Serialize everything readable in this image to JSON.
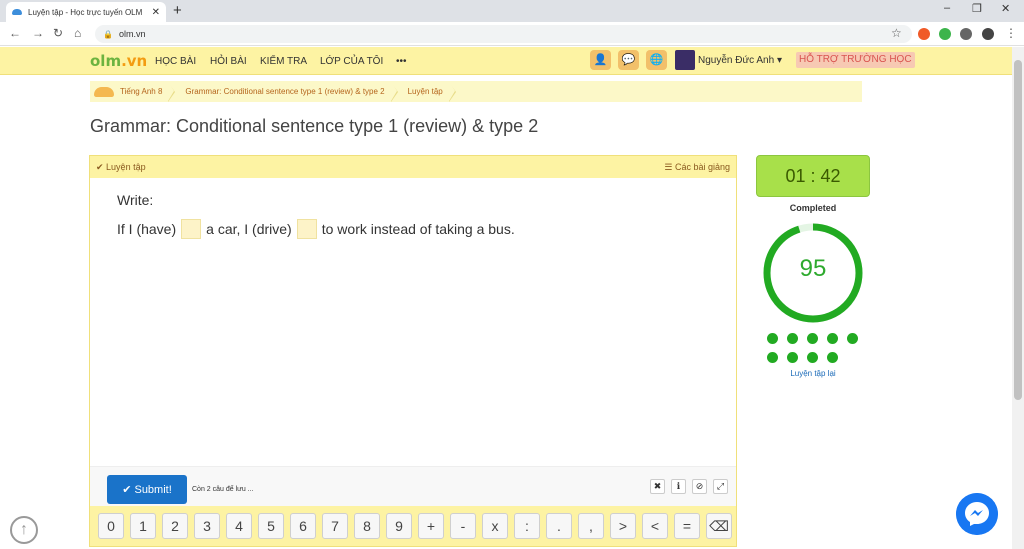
{
  "browser": {
    "tab_title": "Luyện tập - Học trực tuyến OLM",
    "tab_close": "✕",
    "new_tab": "+",
    "url": "olm.vn",
    "controls": {
      "minimize": "–",
      "restore": "❐",
      "close": "✕"
    }
  },
  "header": {
    "logo_o": "olm",
    "logo_v": ".vn",
    "nav": [
      "HỌC BÀI",
      "HỎI BÀI",
      "KIỂM TRA",
      "LỚP CỦA TÔI",
      "•••"
    ],
    "user_name": "Nguyễn Đức Anh",
    "support": "HỖ TRỢ TRƯỜNG HỌC"
  },
  "breadcrumb": [
    "Tiếng Anh 8",
    "Grammar: Conditional sentence type 1 (review) & type 2",
    "Luyện tập"
  ],
  "page_title": "Grammar: Conditional sentence type 1 (review) & type 2",
  "panel": {
    "header_left": "Luyện tập",
    "header_right": "Các bài giảng",
    "instruction": "Write:",
    "sentence": [
      "If I (have)",
      "a car, I (drive)",
      "to work instead of taking a bus."
    ],
    "submit_label": "✔ Submit!",
    "remaining": "Còn 2 câu để lưu ..."
  },
  "keypad": [
    "0",
    "1",
    "2",
    "3",
    "4",
    "5",
    "6",
    "7",
    "8",
    "9",
    "+",
    "-",
    "x",
    ":",
    ".",
    ",",
    ">",
    "<",
    "=",
    "⌫"
  ],
  "result": {
    "timer": "01 : 42",
    "status": "Completed",
    "score": "95",
    "score_fraction": 0.95,
    "retry": "Luyện tập lại"
  },
  "colors": {
    "accent_yellow": "#fdf3a3",
    "timer_green": "#a8e04a",
    "score_green": "#22aa22",
    "submit_blue": "#1a73c9"
  }
}
